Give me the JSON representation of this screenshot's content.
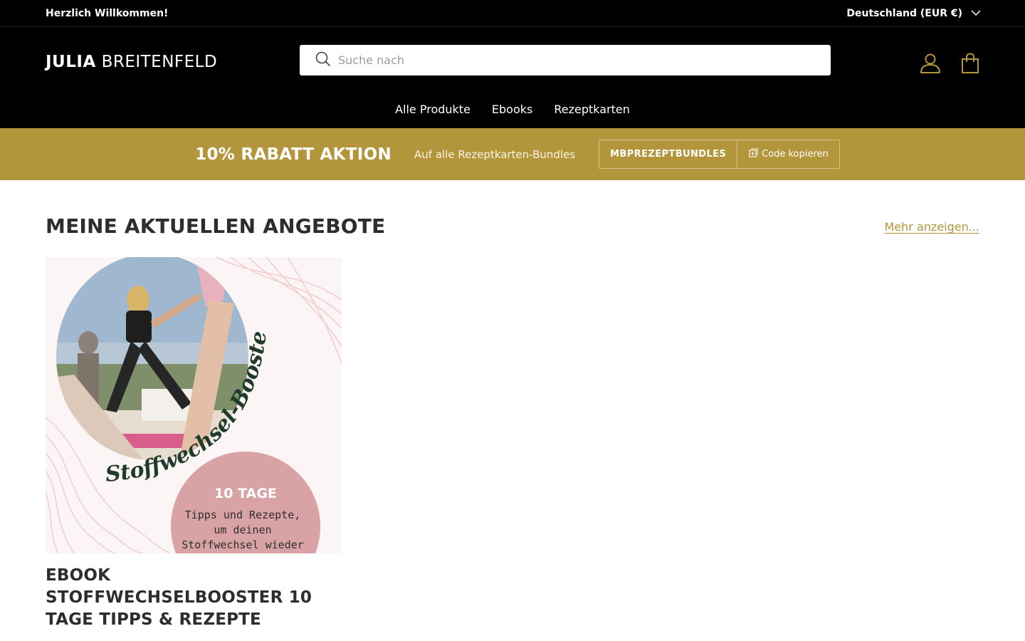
{
  "announcement": {
    "welcome": "Herzlich Willkommen!",
    "country": "Deutschland (EUR €)"
  },
  "header": {
    "logo_bold": "JULIA",
    "logo_light": "BREITENFELD",
    "search_placeholder": "Suche nach",
    "icons": [
      "search-icon",
      "user-icon",
      "cart-bag-icon"
    ]
  },
  "nav": {
    "items": [
      {
        "label": "Alle Produkte"
      },
      {
        "label": "Ebooks"
      },
      {
        "label": "Rezeptkarten"
      }
    ]
  },
  "promo": {
    "headline": "10% RABATT AKTION",
    "subtext": "Auf alle Rezeptkarten-Bundles",
    "code": "MBPREZEPTBUNDLES",
    "copy_label": "Code kopieren",
    "background_color": "#b3963b"
  },
  "section": {
    "title": "MEINE AKTUELLEN ANGEBOTE",
    "more_link": "Mehr anzeigen..."
  },
  "product": {
    "title": "EBOOK STOFFWECHSELBOOSTER 10 TAGE TIPPS & REZEPTE",
    "image": {
      "script_text": "Stoffwechsel-Booster",
      "badge_title": "10 TAGE",
      "badge_line1": "Tipps und Rezepte,",
      "badge_line2": "um deinen",
      "badge_line3": "Stoffwechsel wieder"
    }
  },
  "colors": {
    "accent": "#b3963b",
    "header_bg": "#000000",
    "script_green": "#1f3b2c",
    "badge_pink": "#d9a3a6"
  }
}
